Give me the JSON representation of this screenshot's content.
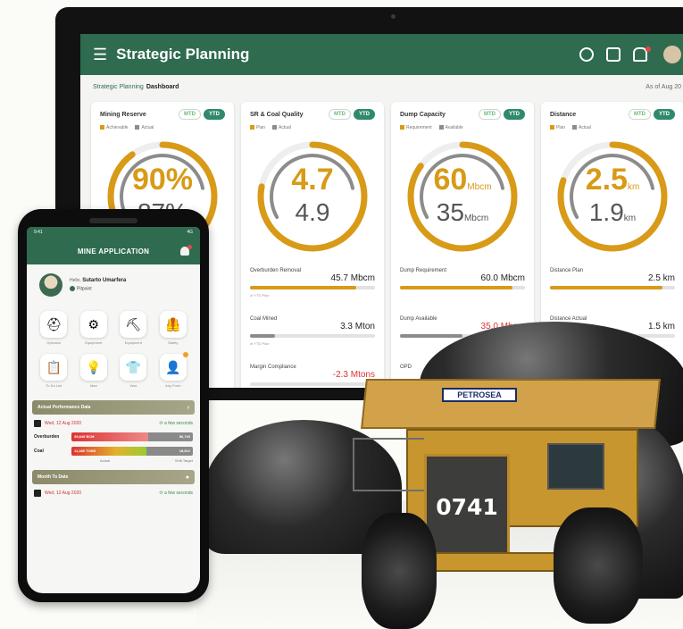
{
  "dashboard": {
    "app_title": "Strategic Planning",
    "breadcrumb": [
      "Strategic Planning",
      "Dashboard"
    ],
    "as_of": "As of Aug 20",
    "toggle": [
      "MTD",
      "YTD"
    ],
    "cards": [
      {
        "title": "Mining Reserve",
        "legend": [
          "Achievable",
          "Actual"
        ],
        "primary": "90%",
        "secondary": "87%",
        "primary_unit": "",
        "secondary_unit": "",
        "gauge_fraction": 0.9,
        "metrics": []
      },
      {
        "title": "SR & Coal Quality",
        "legend": [
          "Plan",
          "Actual"
        ],
        "primary": "4.7",
        "secondary": "4.9",
        "primary_unit": "",
        "secondary_unit": "",
        "gauge_fraction": 0.78,
        "metrics": [
          {
            "label": "Overburden Removal",
            "value": "45.7 Mbcm",
            "fraction": 0.85,
            "color": "gold",
            "sub": "of YTD Plan"
          },
          {
            "label": "Coal Mined",
            "value": "3.3 Mton",
            "fraction": 0.2,
            "color": "gray",
            "sub": "of YTD Plan"
          },
          {
            "label": "Margin Compliance",
            "value": "-2.3 Mtons",
            "fraction": 0,
            "color": "neg",
            "sub": ""
          }
        ]
      },
      {
        "title": "Dump Capacity",
        "legend": [
          "Requirement",
          "Available"
        ],
        "primary": "60",
        "secondary": "35",
        "primary_unit": "Mbcm",
        "secondary_unit": "Mbcm",
        "gauge_fraction": 0.85,
        "metrics": [
          {
            "label": "Dump Requirement",
            "value": "60.0 Mbcm",
            "fraction": 0.9,
            "color": "gold",
            "sub": ""
          },
          {
            "label": "Dump Available",
            "value": "35.0 Mbcm",
            "fraction": 0.5,
            "color": "gray",
            "sub": "",
            "neg": true
          },
          {
            "label": "OPD",
            "value": "",
            "fraction": 0,
            "color": "gray",
            "sub": ""
          }
        ]
      },
      {
        "title": "Distance",
        "legend": [
          "Plan",
          "Actual"
        ],
        "primary": "2.5",
        "secondary": "1.9",
        "primary_unit": "km",
        "secondary_unit": "km",
        "gauge_fraction": 0.8,
        "metrics": [
          {
            "label": "Distance Plan",
            "value": "2.5 km",
            "fraction": 0.9,
            "color": "gold",
            "sub": ""
          },
          {
            "label": "Distance Actual",
            "value": "1.5 km",
            "fraction": 0.5,
            "color": "gray",
            "sub": ""
          }
        ]
      }
    ]
  },
  "phone": {
    "time": "9:41",
    "status": "4G",
    "title": "MINE APPLICATION",
    "user_greeting": "Hello,",
    "user_name": "Sutarto Umarfera",
    "user_role": "Pitpoint",
    "tiles": [
      {
        "label": "Operator",
        "icon": "hardhat-icon",
        "glyph": "⛑"
      },
      {
        "label": "Equipment",
        "icon": "excavator-icon",
        "glyph": "⚙"
      },
      {
        "label": "Equipment",
        "icon": "loader-icon",
        "glyph": "⛏"
      },
      {
        "label": "Safety",
        "icon": "vest-icon",
        "glyph": "🦺"
      },
      {
        "label": "To Do List",
        "icon": "clipboard-icon",
        "glyph": "📋"
      },
      {
        "label": "Idea",
        "icon": "bulb-icon",
        "glyph": "💡"
      },
      {
        "label": "Vest",
        "icon": "vest-icon",
        "glyph": "👕"
      },
      {
        "label": "Any Form",
        "icon": "person-icon",
        "glyph": "👤",
        "badge": true
      }
    ],
    "actual_section": "Actual Performance Data",
    "date_text": "Wed, 12 Aug 2020",
    "updated_text": "a few seconds",
    "rows": [
      {
        "label": "Overburden",
        "left": "35,840 BCM",
        "right": "56,740",
        "fraction": 0.63
      },
      {
        "label": "Coal",
        "left": "11,480 TONS",
        "right": "18,612",
        "fraction": 0.62
      }
    ],
    "footer_left": "Actual",
    "footer_right": "Shift Target",
    "month_section": "Month To Date",
    "date2": "Wed, 12 Aug 2020",
    "updated2": "a few seconds"
  },
  "truck": {
    "brand": "PETROSEA",
    "number": "0741"
  },
  "colors": {
    "brand_green": "#2f6b4f",
    "accent_gold": "#d89a17",
    "secondary_gray": "#8c8c8c",
    "negative_red": "#d33333"
  }
}
